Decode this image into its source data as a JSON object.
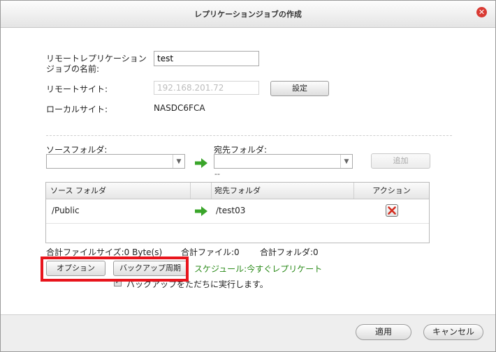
{
  "dialog": {
    "title": "レプリケーションジョブの作成",
    "close_icon": "close-icon"
  },
  "form": {
    "job_name_label": "リモートレプリケーションジョブの名前:",
    "job_name_value": "test",
    "remote_site_label": "リモートサイト:",
    "remote_site_value": "192.168.201.72",
    "settings_button": "設定",
    "local_site_label": "ローカルサイト:",
    "local_site_value": "NASDC6FCA"
  },
  "folders": {
    "source_label": "ソースフォルダ:",
    "dest_label": "宛先フォルダ:",
    "dest_hint": "--",
    "add_button": "追加"
  },
  "table": {
    "columns": [
      "ソース フォルダ",
      "",
      "宛先フォルダ",
      "アクション"
    ],
    "rows": [
      {
        "source": "/Public",
        "dest": "/test03"
      }
    ]
  },
  "stats": {
    "total_size": "合計ファイルサイズ:0 Byte(s)",
    "total_files": "合計ファイル:0",
    "total_folders": "合計フォルダ:0"
  },
  "actions": {
    "options_button": "オプション",
    "backup_cycle_button": "バックアップ周期",
    "schedule_text": "スケジュール:今すぐレプリケート",
    "run_now_label": "バックアップをただちに実行します。",
    "run_now_checked": true
  },
  "footer": {
    "apply_button": "適用",
    "cancel_button": "キャンセル"
  },
  "colors": {
    "highlight": "#e8141c",
    "arrow": "#3aa52a",
    "schedule": "#2a8a18",
    "close": "#d93a33"
  }
}
